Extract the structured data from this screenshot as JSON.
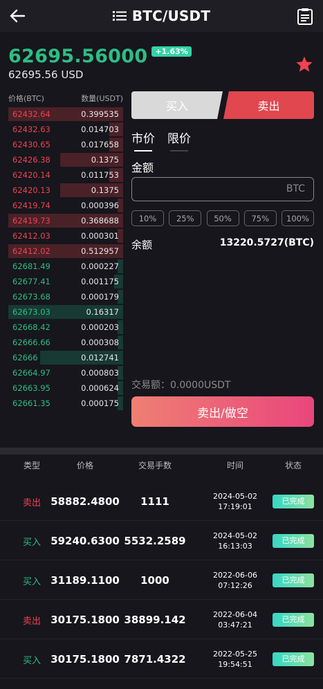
{
  "header": {
    "title": "BTC/USDT",
    "back_icon": "arrow-left-icon",
    "menu_icon": "list-icon",
    "history_icon": "clipboard-icon"
  },
  "ticker": {
    "last_price": "62695.56000",
    "change": "+1.63%",
    "usd_price": "62695.56 USD",
    "favorite_icon": "star-icon",
    "favorite_color": "#f0424f"
  },
  "orderbook": {
    "price_header": "价格(BTC)",
    "qty_header": "数量(USDT)",
    "asks": [
      {
        "price": "62432.64",
        "qty": "0.399535",
        "depth": 1.0
      },
      {
        "price": "62432.63",
        "qty": "0.014703",
        "depth": 0.12
      },
      {
        "price": "62430.65",
        "qty": "0.017658",
        "depth": 0.12
      },
      {
        "price": "62426.38",
        "qty": "0.1375",
        "depth": 0.55
      },
      {
        "price": "62420.14",
        "qty": "0.011753",
        "depth": 0.12
      },
      {
        "price": "62420.13",
        "qty": "0.1375",
        "depth": 0.55
      },
      {
        "price": "62419.74",
        "qty": "0.000396",
        "depth": 0.05
      },
      {
        "price": "62419.73",
        "qty": "0.368688",
        "depth": 1.0
      },
      {
        "price": "62412.03",
        "qty": "0.000301",
        "depth": 0.05
      },
      {
        "price": "62412.02",
        "qty": "0.512957",
        "depth": 1.0
      }
    ],
    "bids": [
      {
        "price": "62681.49",
        "qty": "0.000227",
        "depth": 0.05
      },
      {
        "price": "62677.41",
        "qty": "0.001175",
        "depth": 0.08
      },
      {
        "price": "62673.68",
        "qty": "0.000179",
        "depth": 0.05
      },
      {
        "price": "62673.03",
        "qty": "0.16317",
        "depth": 1.0
      },
      {
        "price": "62668.42",
        "qty": "0.000203",
        "depth": 0.05
      },
      {
        "price": "62666.66",
        "qty": "0.000308",
        "depth": 0.05
      },
      {
        "price": "62666",
        "qty": "0.012741",
        "depth": 0.72
      },
      {
        "price": "62664.97",
        "qty": "0.000803",
        "depth": 0.05
      },
      {
        "price": "62663.95",
        "qty": "0.000624",
        "depth": 0.05
      },
      {
        "price": "62661.35",
        "qty": "0.000175",
        "depth": 0.05
      }
    ],
    "ask_color": "#f0424f",
    "bid_color": "#2ebd85"
  },
  "trade": {
    "buy_label": "买入",
    "sell_label": "卖出",
    "market_tab": "市价",
    "limit_tab": "限价",
    "amount_label": "金额",
    "amount_placeholder": "",
    "amount_unit": "BTC",
    "percents": [
      "10%",
      "25%",
      "50%",
      "75%",
      "100%"
    ],
    "balance_label": "余额",
    "balance_value": "13220.5727(BTC)",
    "trade_amount": "交易额：0.0000USDT",
    "submit_label": "卖出/做空"
  },
  "history": {
    "columns": {
      "type": "类型",
      "price": "价格",
      "qty": "交易手数",
      "time": "时间",
      "status": "状态"
    },
    "rows": [
      {
        "type": "卖出",
        "side": "sell",
        "price": "58882.4800",
        "qty": "1111",
        "date": "2024-05-02",
        "time": "17:19:01",
        "status": "已完成"
      },
      {
        "type": "买入",
        "side": "buy",
        "price": "59240.6300",
        "qty": "5532.2589",
        "date": "2024-05-02",
        "time": "16:13:03",
        "status": "已完成"
      },
      {
        "type": "买入",
        "side": "buy",
        "price": "31189.1100",
        "qty": "1000",
        "date": "2022-06-06",
        "time": "07:12:26",
        "status": "已完成"
      },
      {
        "type": "卖出",
        "side": "sell",
        "price": "30175.1800",
        "qty": "38899.142",
        "date": "2022-06-04",
        "time": "03:47:21",
        "status": "已完成"
      },
      {
        "type": "买入",
        "side": "buy",
        "price": "30175.1800",
        "qty": "7871.4322",
        "date": "2022-05-25",
        "time": "19:54:51",
        "status": "已完成"
      }
    ]
  }
}
